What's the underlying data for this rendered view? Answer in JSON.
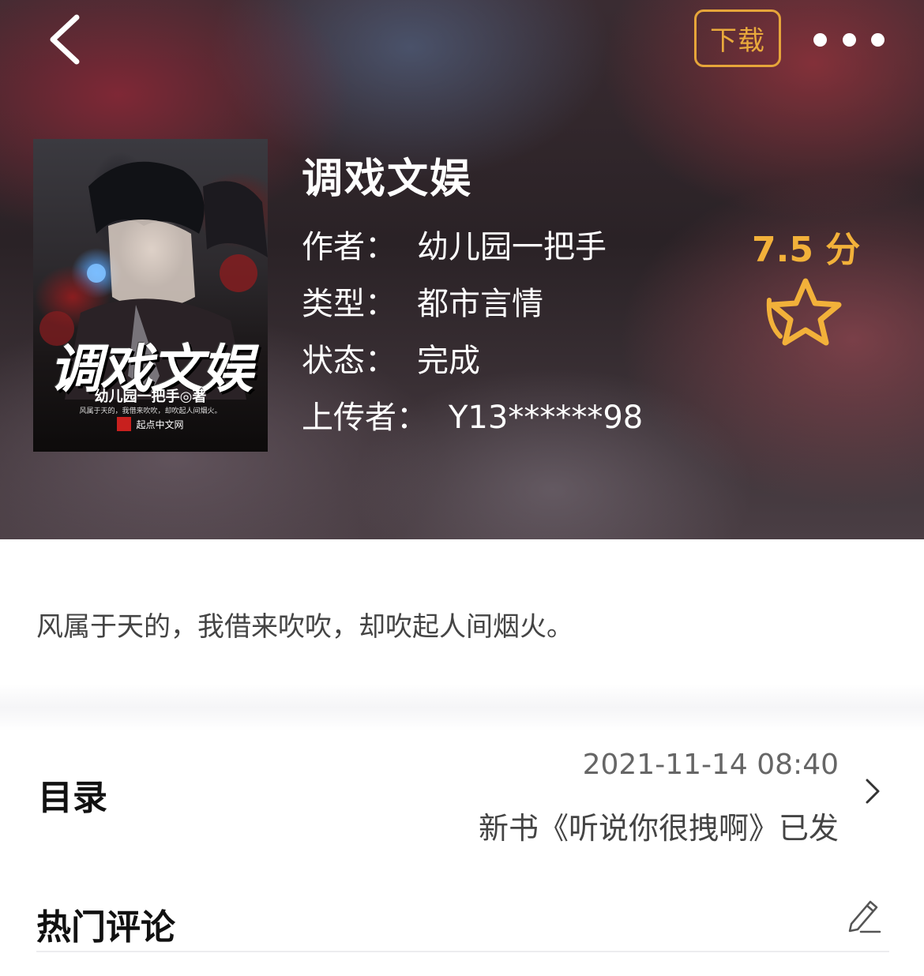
{
  "colors": {
    "accent": "#e9aa3c",
    "score": "#f2b13a",
    "header_text": "#ffffff"
  },
  "header": {
    "back_icon": "chevron-left-icon",
    "download_label": "下载",
    "more_icon": "more-dots-icon"
  },
  "book": {
    "cover": {
      "title": "调戏文娱",
      "author_line": "幼儿园一把手◎著",
      "tagline": "风属于天的，我借来吹吹，却吹起人间烟火。",
      "publisher": "起点中文网"
    },
    "title": "调戏文娱",
    "author_label": "作者：",
    "author": "幼儿园一把手",
    "genre_label": "类型：",
    "genre": "都市言情",
    "status_label": "状态：",
    "status": "完成",
    "uploader_label": "上传者：",
    "uploader": "Y13******98",
    "score": "7.5 分",
    "star_icon": "star-outline-icon"
  },
  "intro": "风属于天的，我借来吹吹，却吹起人间烟火。",
  "toc": {
    "label": "目录",
    "updated_time": "2021-11-14 08:40",
    "latest_chapter": "新书《听说你很拽啊》已发",
    "chevron_icon": "chevron-right-icon"
  },
  "comments": {
    "title": "热门评论",
    "edit_icon": "pencil-icon"
  }
}
